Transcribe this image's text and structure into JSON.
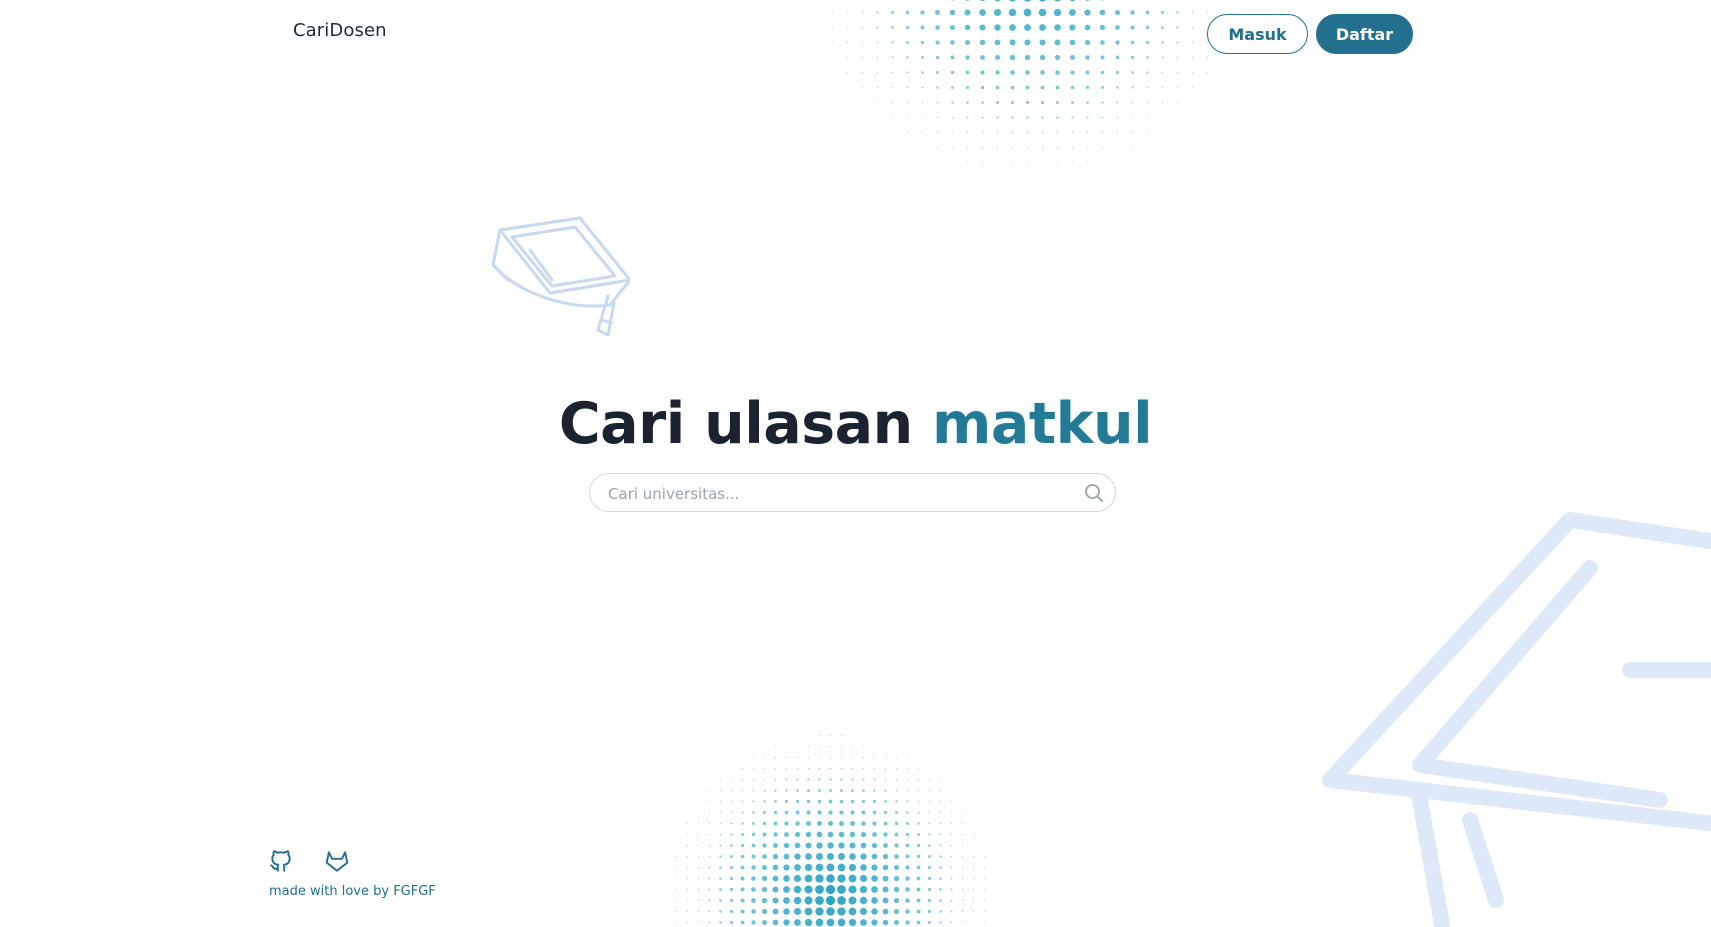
{
  "header": {
    "brand": "CariDosen",
    "login_label": "Masuk",
    "register_label": "Daftar"
  },
  "hero": {
    "title_main": "Cari ulasan",
    "title_accent": "matkul"
  },
  "search": {
    "placeholder": "Cari universitas...",
    "value": "",
    "icon": "search-icon"
  },
  "footer": {
    "links": [
      {
        "icon": "github-icon"
      },
      {
        "icon": "gitlab-icon"
      }
    ],
    "credit": "made with love by FGFGF"
  },
  "decorations": {
    "small_cap": "graduation-cap-icon",
    "large_cap": "graduation-cap-icon"
  },
  "colors": {
    "brand": "#226f8e",
    "accent_text": "#227a96",
    "title_dark": "#1b2230",
    "dots": "#2ba3c4",
    "cap_tint": "#c9dcf2"
  }
}
